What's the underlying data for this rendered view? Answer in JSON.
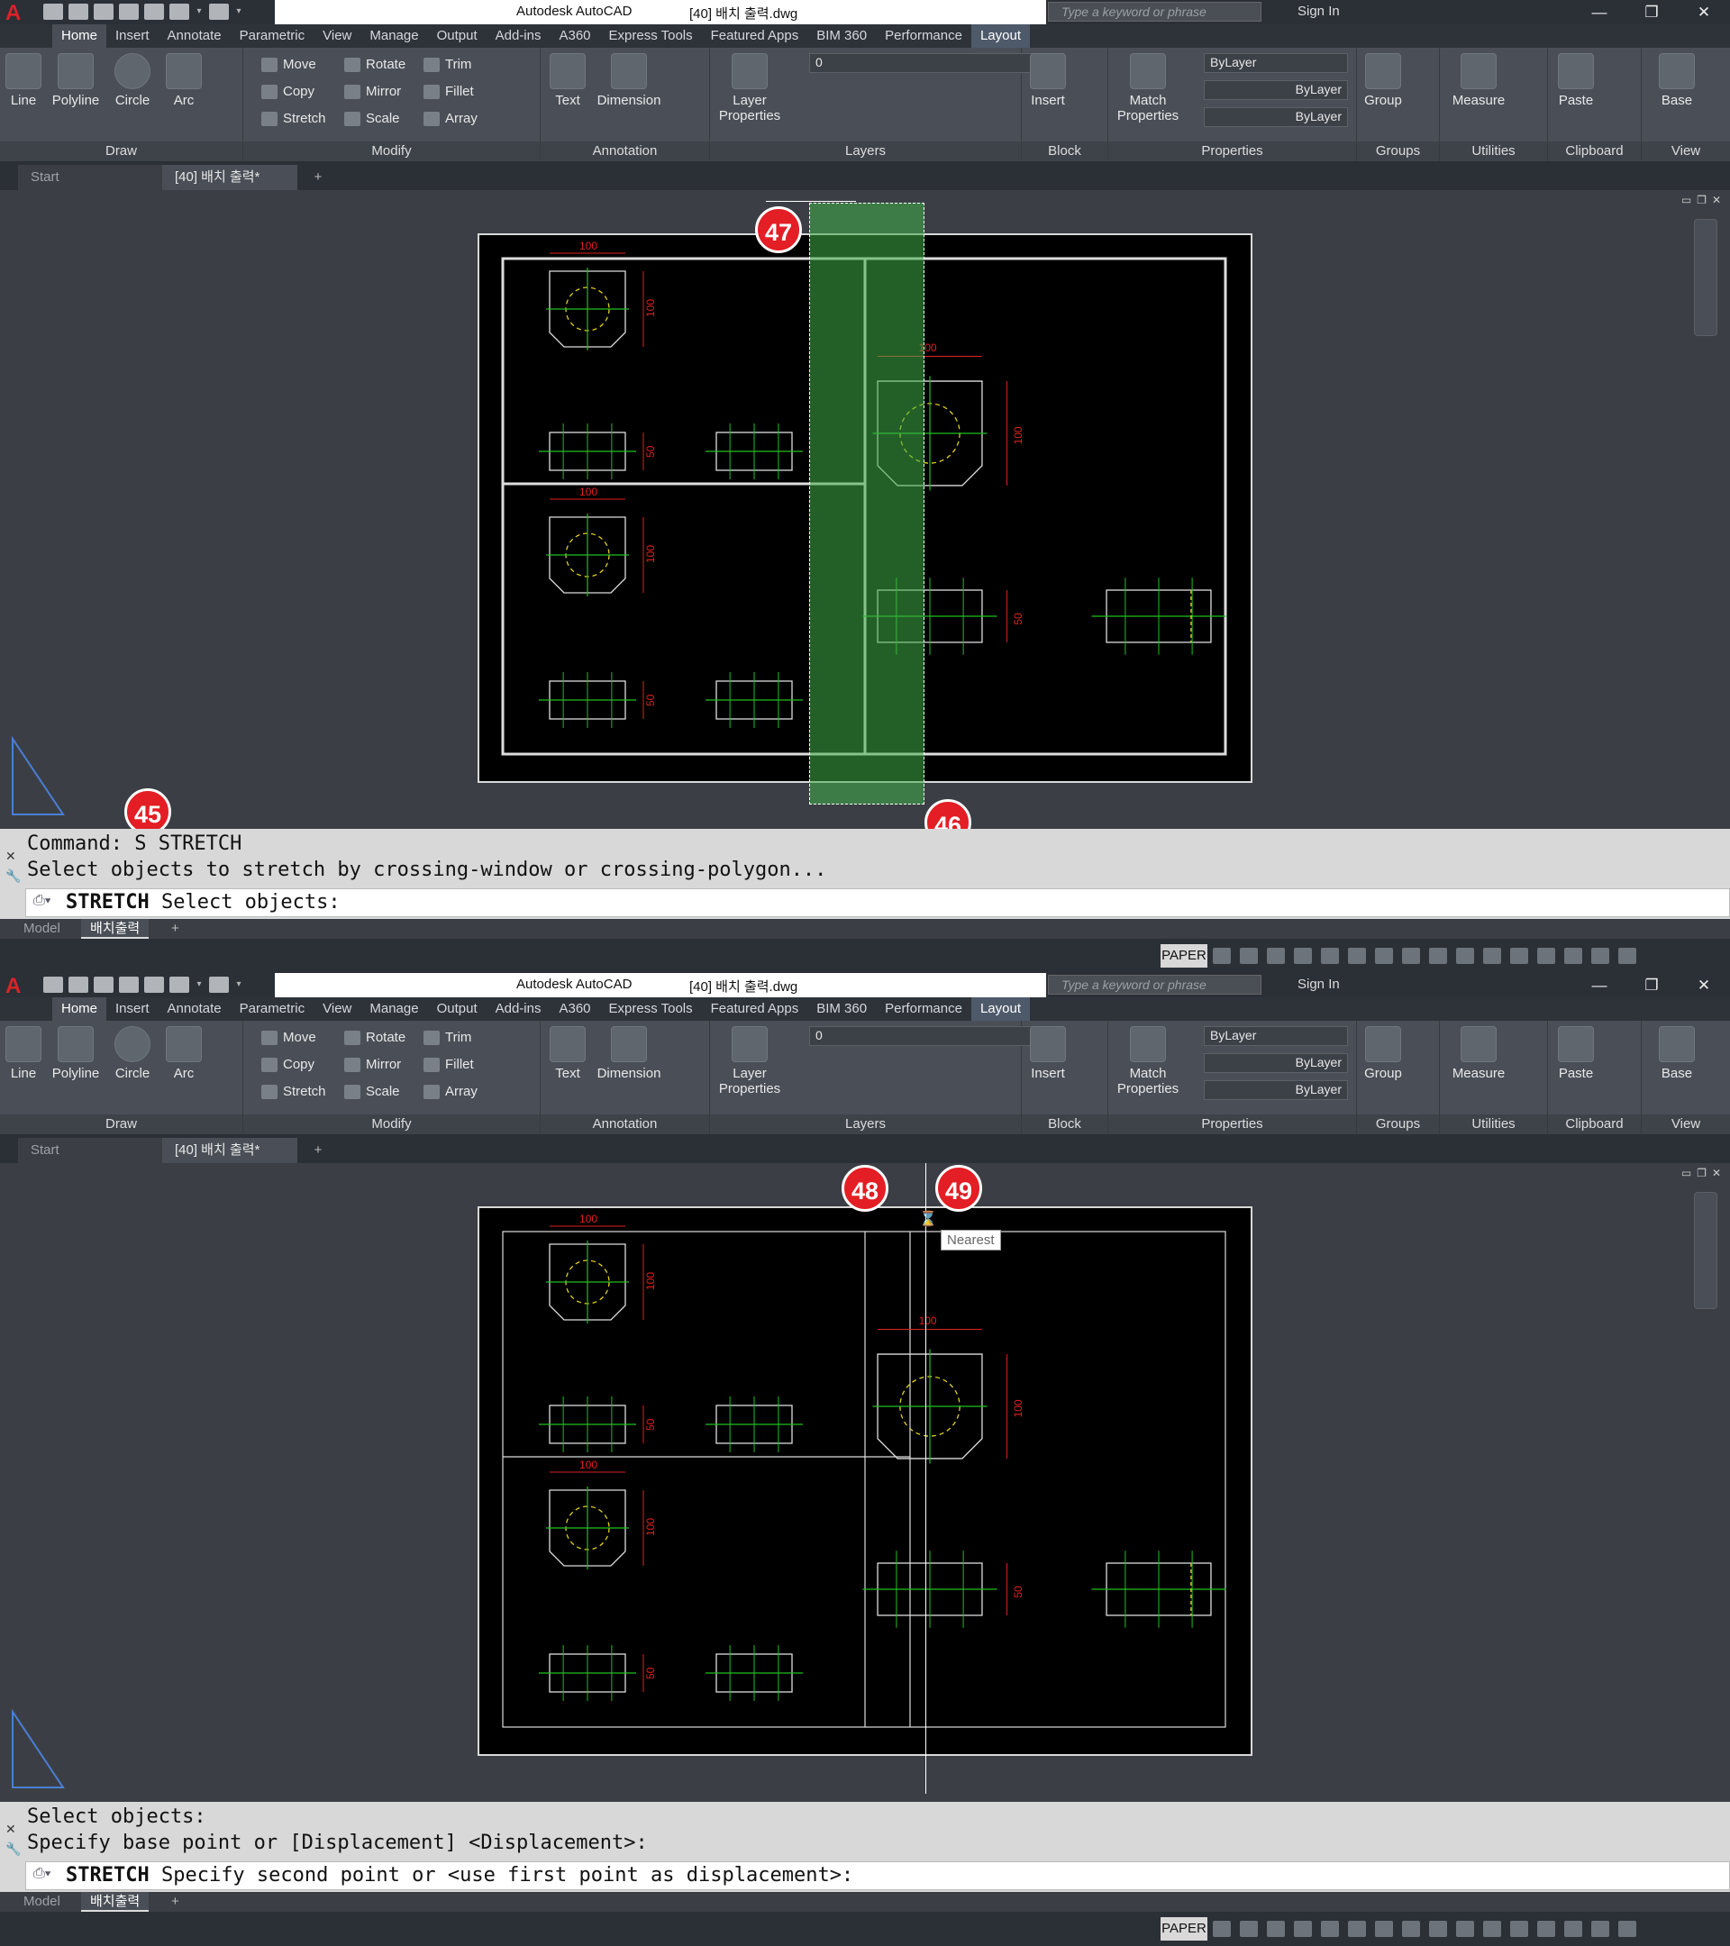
{
  "app": {
    "title": "Autodesk AutoCAD",
    "document": "[40] 배치 출력.dwg",
    "search_placeholder": "Type a keyword or phrase",
    "sign_in": "Sign In",
    "window_buttons": [
      "—",
      "❐",
      "✕"
    ]
  },
  "ribbon_tabs": [
    "Home",
    "Insert",
    "Annotate",
    "Parametric",
    "View",
    "Manage",
    "Output",
    "Add-ins",
    "A360",
    "Express Tools",
    "Featured Apps",
    "BIM 360",
    "Performance",
    "Layout"
  ],
  "ribbon": {
    "draw": {
      "title": "Draw",
      "line": "Line",
      "polyline": "Polyline",
      "circle": "Circle",
      "arc": "Arc"
    },
    "modify": {
      "title": "Modify",
      "move": "Move",
      "rotate": "Rotate",
      "trim": "Trim",
      "copy": "Copy",
      "mirror": "Mirror",
      "fillet": "Fillet",
      "stretch": "Stretch",
      "scale": "Scale",
      "array": "Array"
    },
    "annotation": {
      "title": "Annotation",
      "text": "Text",
      "dimension": "Dimension"
    },
    "layers": {
      "title": "Layers",
      "layer_properties": "Layer Properties",
      "current_layer": "0"
    },
    "block": {
      "title": "Block",
      "insert": "Insert"
    },
    "properties": {
      "title": "Properties",
      "match": "Match Properties",
      "color": "ByLayer",
      "linetype": "ByLayer",
      "lineweight": "ByLayer"
    },
    "groups": {
      "title": "Groups",
      "group": "Group"
    },
    "utilities": {
      "title": "Utilities",
      "measure": "Measure"
    },
    "clipboard": {
      "title": "Clipboard",
      "paste": "Paste"
    },
    "view": {
      "title": "View",
      "base": "Base"
    }
  },
  "doc_tabs": {
    "start": "Start",
    "current": "[40] 배치 출력*",
    "add": "+"
  },
  "layout_tabs": {
    "model": "Model",
    "layout": "배치출력",
    "add": "+"
  },
  "drawing": {
    "dim_100": "100",
    "dim_50": "50"
  },
  "status": {
    "paper": "PAPER"
  },
  "screens": {
    "top": {
      "cmd_lines": [
        "Command: S STRETCH",
        "Select objects to stretch by crossing-window or crossing-polygon..."
      ],
      "prompt_cmd": "STRETCH",
      "prompt_text": " Select objects:",
      "badges": [
        "45",
        "46",
        "47"
      ]
    },
    "bottom": {
      "cmd_lines": [
        "Select objects:",
        "Specify base point or [Displacement] <Displacement>:"
      ],
      "prompt_cmd": "STRETCH",
      "prompt_text": " Specify second point or <use first point as displacement>:",
      "badges": [
        "48",
        "49"
      ],
      "tooltip": "Nearest"
    }
  },
  "colors": {
    "badge": "#e31e24",
    "crossing": "#3fae49",
    "dim": "#e02020",
    "center": "#20c020",
    "hidden": "#e0d020"
  }
}
